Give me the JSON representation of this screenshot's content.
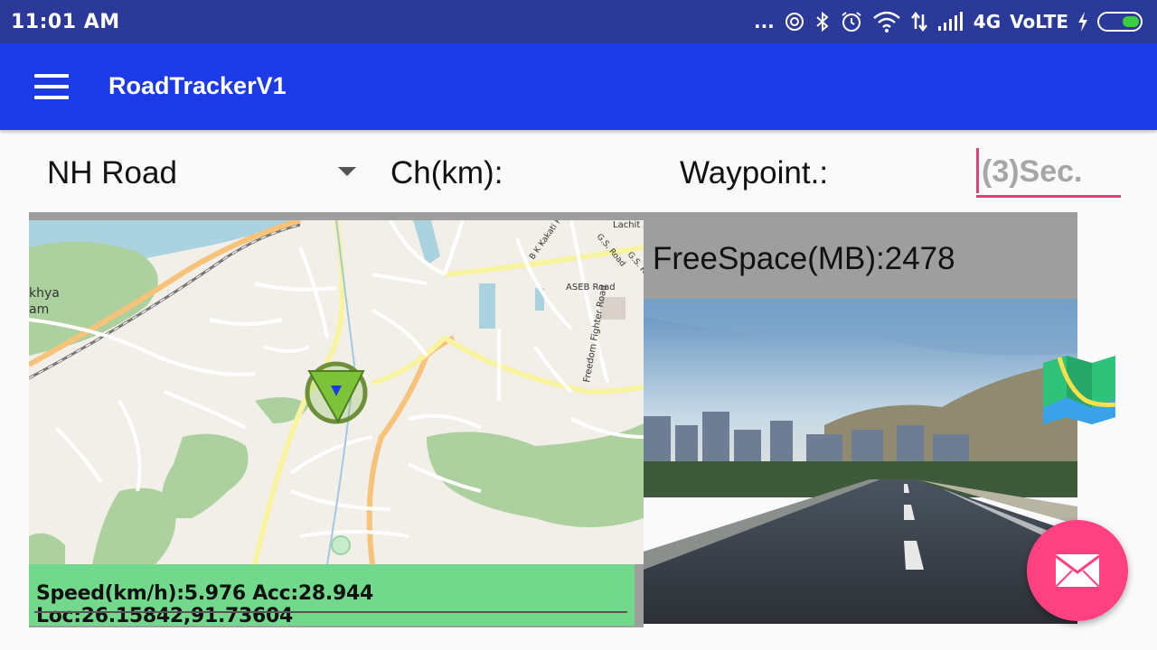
{
  "status_bar": {
    "time": "11:01 AM",
    "more": "...",
    "network_label": "4G",
    "volte_label": "VoLTE"
  },
  "app_bar": {
    "title": "RoadTrackerV1"
  },
  "controls": {
    "road_type_selected": "NH Road",
    "chainage_label": "Ch(km):",
    "waypoint_label": "Waypoint.:",
    "interval_placeholder": "(3)Sec."
  },
  "map": {
    "labels": [
      "Lachit N",
      "B K Kakati R",
      "G.S. Road",
      "G.S. R",
      "ASEB Road",
      "Freedom Fighter Road",
      "khya",
      "am"
    ]
  },
  "telemetry": {
    "text": "Speed(km/h):5.976 Acc:28.944 Loc:26.15842,91.73604"
  },
  "storage": {
    "text": "FreeSpace(MB):2478"
  },
  "colors": {
    "status_bar": "#2b3a99",
    "app_bar": "#1c3ae6",
    "accent": "#ff4081",
    "telemetry_bg": "#72d98c",
    "panel_gray": "#9e9e9e"
  }
}
